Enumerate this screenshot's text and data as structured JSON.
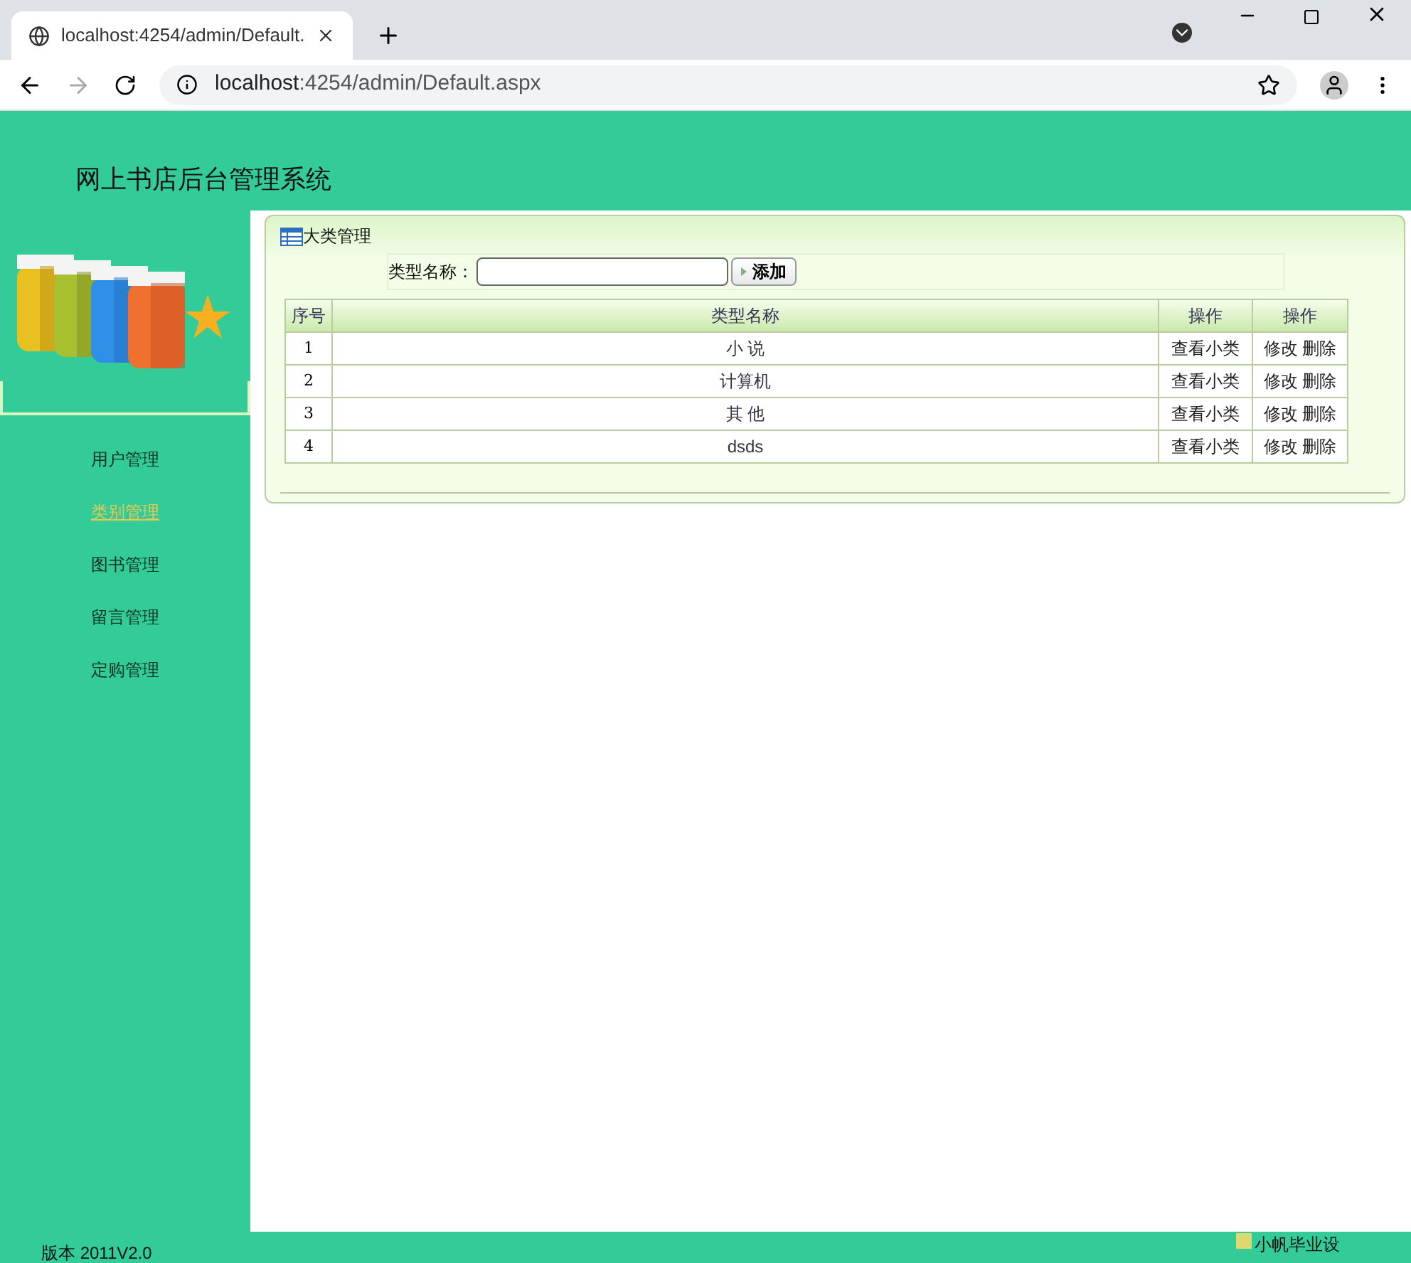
{
  "browser": {
    "tab_title": "localhost:4254/admin/Default.",
    "url_host": "localhost",
    "url_path": ":4254/admin/Default.aspx"
  },
  "header": {
    "title": "网上书店后台管理系统"
  },
  "sidebar": {
    "items": [
      {
        "label": "用户管理",
        "selected": false
      },
      {
        "label": "类别管理",
        "selected": true
      },
      {
        "label": "图书管理",
        "selected": false
      },
      {
        "label": "留言管理",
        "selected": false
      },
      {
        "label": "定购管理",
        "selected": false
      }
    ]
  },
  "panel": {
    "title": "大类管理",
    "form_label": "类型名称：",
    "add_button": "添加",
    "table": {
      "columns": [
        "序号",
        "类型名称",
        "操作",
        "操作"
      ],
      "rows": [
        {
          "index": "1",
          "name": "小 说",
          "view": "查看小类",
          "edit": "修改",
          "delete": "删除"
        },
        {
          "index": "2",
          "name": "计算机",
          "view": "查看小类",
          "edit": "修改",
          "delete": "删除"
        },
        {
          "index": "3",
          "name": "其 他",
          "view": "查看小类",
          "edit": "修改",
          "delete": "删除"
        },
        {
          "index": "4",
          "name": "dsds",
          "view": "查看小类",
          "edit": "修改",
          "delete": "删除"
        }
      ]
    }
  },
  "footer": {
    "version": "版本 2011V2.0",
    "credit": "小帆毕业设"
  }
}
